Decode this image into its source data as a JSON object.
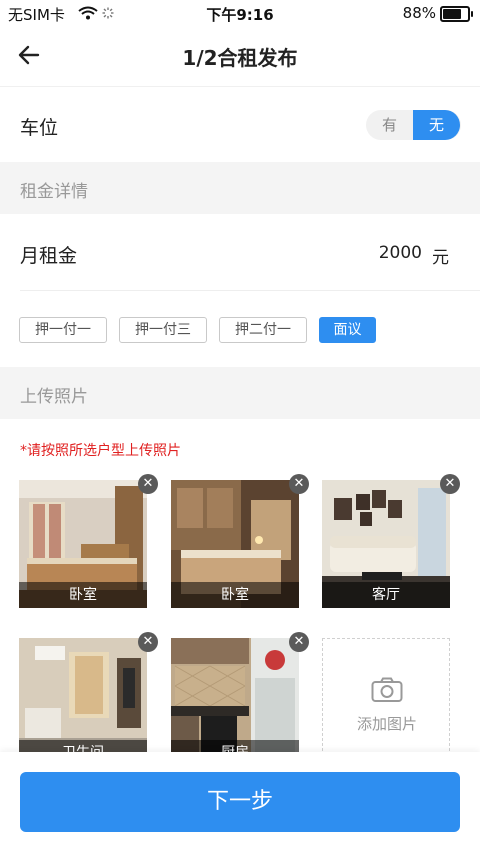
{
  "status_bar": {
    "carrier": "无SIM卡",
    "time": "下午9:16",
    "battery_percent": "88%",
    "battery_level": 0.88
  },
  "header": {
    "title": "1/2合租发布",
    "back_icon": "arrow-left-icon"
  },
  "parking": {
    "label": "车位",
    "options": [
      "有",
      "无"
    ],
    "selected": "无"
  },
  "rent_section": {
    "heading": "租金详情",
    "monthly_rent_label": "月租金",
    "monthly_rent_value": "2000",
    "unit": "元"
  },
  "payment_methods": {
    "options": [
      "押一付一",
      "押一付三",
      "押二付一",
      "面议"
    ],
    "selected": "面议"
  },
  "photos_section": {
    "heading": "上传照片",
    "notice": "*请按照所选户型上传照片",
    "photos": [
      {
        "caption": "卧室"
      },
      {
        "caption": "卧室"
      },
      {
        "caption": "客厅"
      },
      {
        "caption": "卫生间"
      },
      {
        "caption": "厨房"
      }
    ],
    "remove_icon": "close-icon",
    "add_label": "添加图片",
    "add_icon": "camera-icon"
  },
  "footer": {
    "next_label": "下一步"
  },
  "colors": {
    "accent": "#2e8ef0",
    "notice": "#e02020",
    "section_bg": "#f4f4f4"
  }
}
